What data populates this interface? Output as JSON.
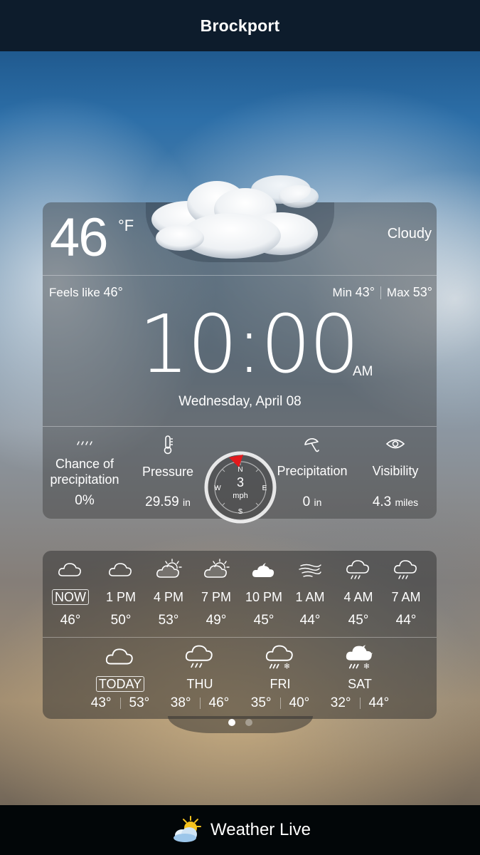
{
  "header": {
    "title": "Brockport"
  },
  "current": {
    "temperature": "46",
    "unit": "°F",
    "condition": "Cloudy",
    "feels_like_label": "Feels like",
    "feels_like_value": "46°",
    "min_label": "Min",
    "min_value": "43°",
    "max_label": "Max",
    "max_value": "53°",
    "time": "10:00",
    "ampm": "AM",
    "date": "Wednesday, April 08"
  },
  "stats": {
    "chance": {
      "label_line1": "Chance of",
      "label_line2": "precipitation",
      "value": "0%",
      "icon": "rain-dashes-icon"
    },
    "pressure": {
      "label": "Pressure",
      "value": "29.59",
      "unit": "in",
      "icon": "thermometer-icon"
    },
    "wind": {
      "speed": "3",
      "unit": "mph",
      "n": "N",
      "e": "E",
      "s": "S",
      "w": "W"
    },
    "precipitation": {
      "label": "Precipitation",
      "value": "0",
      "unit": "in",
      "icon": "umbrella-icon"
    },
    "visibility": {
      "label": "Visibility",
      "value": "4.3",
      "unit": "miles",
      "icon": "eye-icon"
    }
  },
  "hourly": [
    {
      "time": "NOW",
      "temp": "46°",
      "icon": "cloud-icon"
    },
    {
      "time": "1 PM",
      "temp": "50°",
      "icon": "cloud-icon"
    },
    {
      "time": "4 PM",
      "temp": "53°",
      "icon": "sun-cloud-icon"
    },
    {
      "time": "7 PM",
      "temp": "49°",
      "icon": "sun-cloud-icon"
    },
    {
      "time": "10 PM",
      "temp": "45°",
      "icon": "night-cloud-icon"
    },
    {
      "time": "1 AM",
      "temp": "44°",
      "icon": "wind-icon"
    },
    {
      "time": "4 AM",
      "temp": "45°",
      "icon": "rain-cloud-icon"
    },
    {
      "time": "7 AM",
      "temp": "44°",
      "icon": "rain-cloud-icon"
    }
  ],
  "daily": [
    {
      "day": "TODAY",
      "low": "43°",
      "high": "53°",
      "icon": "cloud-icon"
    },
    {
      "day": "THU",
      "low": "38°",
      "high": "46°",
      "icon": "rain-cloud-icon"
    },
    {
      "day": "FRI",
      "low": "35°",
      "high": "40°",
      "icon": "sleet-cloud-icon"
    },
    {
      "day": "SAT",
      "low": "32°",
      "high": "44°",
      "icon": "sleet-night-cloud-icon"
    }
  ],
  "footer": {
    "app_name": "Weather Live"
  }
}
